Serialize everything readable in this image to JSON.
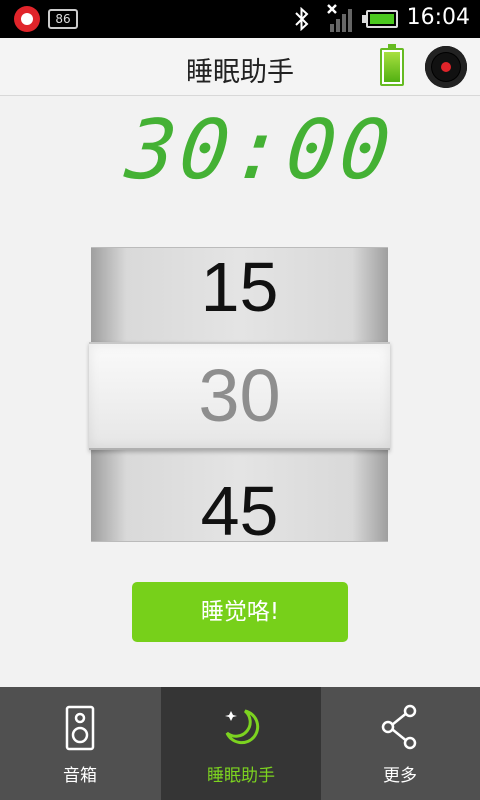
{
  "status_bar": {
    "badge": "86",
    "time": "16:04"
  },
  "header": {
    "title": "睡眠助手"
  },
  "timer": {
    "display": "30:00",
    "color": "#44b134"
  },
  "picker": {
    "above": "15",
    "selected": "30",
    "below": "45"
  },
  "action": {
    "sleep_label": "睡觉咯!",
    "color": "#77d01a"
  },
  "bottom_nav": {
    "items": [
      {
        "label": "音箱",
        "icon": "speaker-icon",
        "active": false
      },
      {
        "label": "睡眠助手",
        "icon": "moon-icon",
        "active": true
      },
      {
        "label": "更多",
        "icon": "share-icon",
        "active": false
      }
    ],
    "active_color": "#7cd320"
  }
}
